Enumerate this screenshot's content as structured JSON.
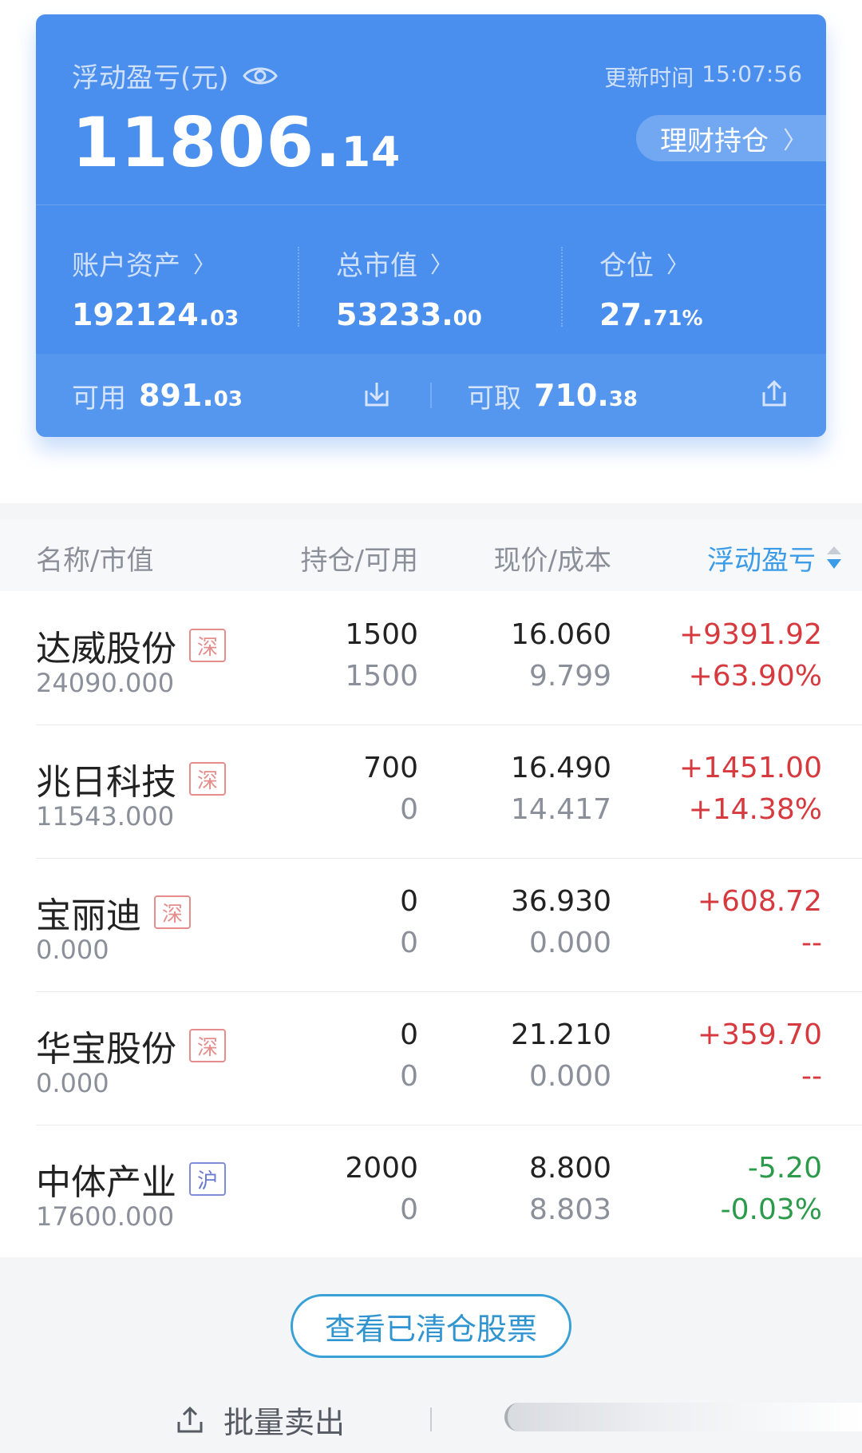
{
  "summary": {
    "pnl_label": "浮动盈亏(元)",
    "update_label": "更新时间",
    "update_time": "15:07:56",
    "pnl_int": "11806.",
    "pnl_dec": "14",
    "wealth_button": "理财持仓",
    "metrics": [
      {
        "label": "账户资产",
        "int": "192124.",
        "dec": "03"
      },
      {
        "label": "总市值",
        "int": "53233.",
        "dec": "00"
      },
      {
        "label": "仓位",
        "int": "27.",
        "dec": "71%"
      }
    ],
    "available_label": "可用",
    "available_int": "891.",
    "available_dec": "03",
    "withdrawable_label": "可取",
    "withdrawable_int": "710.",
    "withdrawable_dec": "38"
  },
  "table": {
    "headers": {
      "name": "名称/市值",
      "position": "持仓/可用",
      "price": "现价/成本",
      "pnl": "浮动盈亏"
    },
    "rows": [
      {
        "name": "达威股份",
        "market": "深",
        "value": "24090.000",
        "hold": "1500",
        "avail": "1500",
        "price": "16.060",
        "cost": "9.799",
        "pnl": "+9391.92",
        "pct": "+63.90%"
      },
      {
        "name": "兆日科技",
        "market": "深",
        "value": "11543.000",
        "hold": "700",
        "avail": "0",
        "price": "16.490",
        "cost": "14.417",
        "pnl": "+1451.00",
        "pct": "+14.38%"
      },
      {
        "name": "宝丽迪",
        "market": "深",
        "value": "0.000",
        "hold": "0",
        "avail": "0",
        "price": "36.930",
        "cost": "0.000",
        "pnl": "+608.72",
        "pct": "--"
      },
      {
        "name": "华宝股份",
        "market": "深",
        "value": "0.000",
        "hold": "0",
        "avail": "0",
        "price": "21.210",
        "cost": "0.000",
        "pnl": "+359.70",
        "pct": "--"
      },
      {
        "name": "中体产业",
        "market": "沪",
        "value": "17600.000",
        "hold": "2000",
        "avail": "0",
        "price": "8.800",
        "cost": "8.803",
        "pnl": "-5.20",
        "pct": "-0.03%"
      }
    ]
  },
  "footer": {
    "cleared_button": "查看已清仓股票",
    "batch_sell": "批量卖出"
  },
  "colors": {
    "card": "#4b8fee",
    "up": "#d63a3f",
    "down": "#2c9a4b",
    "accent": "#3b9be6"
  },
  "icons": [
    "eye-icon",
    "chevron-right-icon",
    "download-icon",
    "upload-icon",
    "sort-icon",
    "export-icon"
  ]
}
